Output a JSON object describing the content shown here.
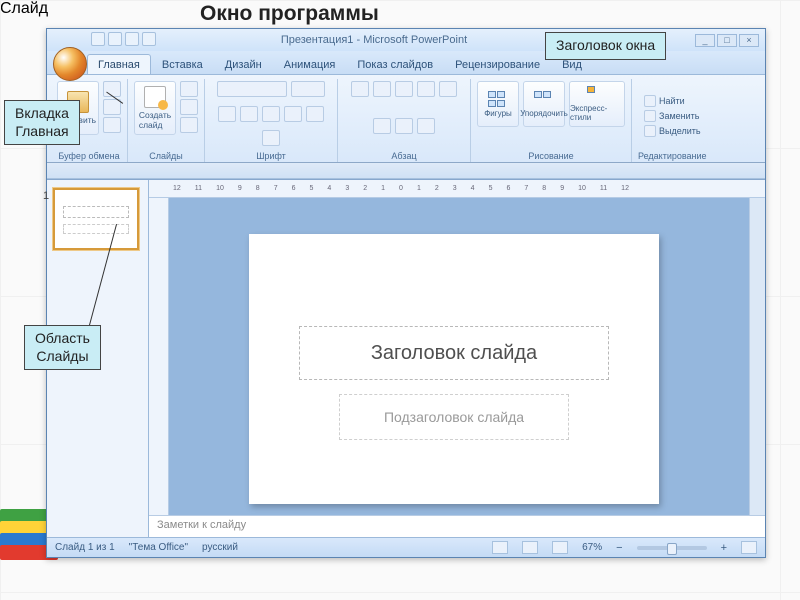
{
  "page_heading": "Окно программы",
  "callouts": {
    "window_title": "Заголовок окна",
    "tab_main_line1": "Вкладка",
    "tab_main_line2": "Главная",
    "slides_pane_line1": "Область",
    "slides_pane_line2": "Слайды",
    "slide": "Слайд"
  },
  "window": {
    "title": "Презентация1 - Microsoft PowerPoint",
    "controls": {
      "min": "_",
      "max": "□",
      "close": "×"
    }
  },
  "tabs": [
    "Главная",
    "Вставка",
    "Дизайн",
    "Анимация",
    "Показ слайдов",
    "Рецензирование",
    "Вид"
  ],
  "ribbon": {
    "paste": "Вставить",
    "clipboard_label": "Буфер обмена",
    "new_slide": "Создать\nслайд",
    "slides_label": "Слайды",
    "font_label": "Шрифт",
    "para_label": "Абзац",
    "shapes": "Фигуры",
    "arrange": "Упорядочить",
    "quickstyles": "Экспресс-стили",
    "drawing_label": "Рисование",
    "find": "Найти",
    "replace": "Заменить",
    "select": "Выделить",
    "editing_label": "Редактирование"
  },
  "ruler_ticks": [
    "12",
    "11",
    "10",
    "9",
    "8",
    "7",
    "6",
    "5",
    "4",
    "3",
    "2",
    "1",
    "0",
    "1",
    "2",
    "3",
    "4",
    "5",
    "6",
    "7",
    "8",
    "9",
    "10",
    "11",
    "12"
  ],
  "slide_content": {
    "title_placeholder": "Заголовок слайда",
    "subtitle_placeholder": "Подзаголовок слайда"
  },
  "thumb_number": "1",
  "notes_placeholder": "Заметки к слайду",
  "status": {
    "slide_info": "Слайд 1 из 1",
    "theme": "\"Тема Office\"",
    "lang": "русский",
    "zoom": "67%"
  }
}
